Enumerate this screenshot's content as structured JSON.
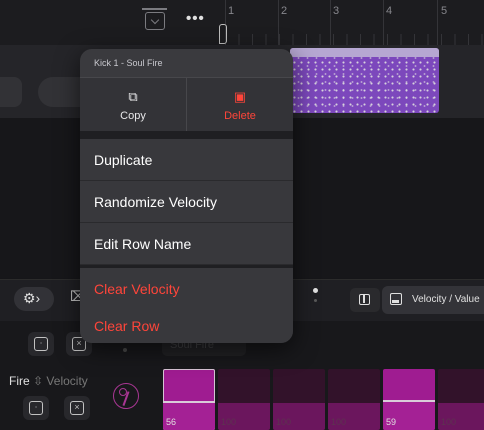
{
  "timeline": {
    "ruler": [
      "1",
      "2",
      "3",
      "4",
      "5"
    ],
    "more_icon": "•••"
  },
  "context_menu": {
    "header": "Kick 1 - Soul Fire",
    "actions": {
      "copy": {
        "label": "Copy",
        "icon": "copy-icon"
      },
      "delete": {
        "label": "Delete",
        "icon": "trash-icon",
        "color": "#ff453a"
      }
    },
    "items": [
      {
        "label": "Duplicate"
      },
      {
        "label": "Randomize Velocity"
      },
      {
        "label": "Edit Row Name"
      },
      {
        "label": "Clear Velocity",
        "destructive": true
      },
      {
        "label": "Clear Row",
        "destructive": true
      }
    ]
  },
  "toolbar": {
    "mode_label": "Velocity / Value"
  },
  "pattern": {
    "row_name_chip": "Soul Fire",
    "track_name": "Fire",
    "track_param": "Velocity",
    "accent_color": "#b520a5",
    "steps": [
      {
        "value": "56",
        "active": true,
        "level": 0.44
      },
      {
        "value": "100",
        "active": false,
        "level": 0.44
      },
      {
        "value": "100",
        "active": false,
        "level": 0.44
      },
      {
        "value": "100",
        "active": false,
        "level": 0.44
      },
      {
        "value": "59",
        "active": true,
        "level": 0.46
      },
      {
        "value": "100",
        "active": false,
        "level": 0.44
      }
    ]
  }
}
